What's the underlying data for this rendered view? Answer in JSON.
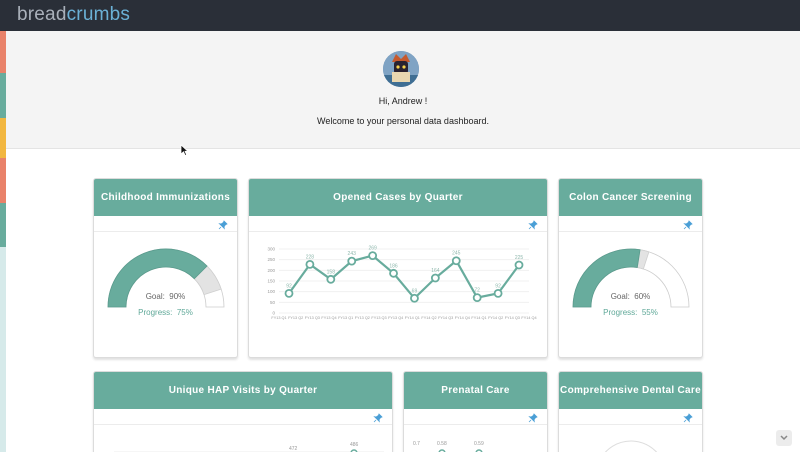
{
  "brand": {
    "part1": "bread",
    "part2": "crumbs"
  },
  "sidebar_strip_colors": [
    "#e9826a",
    "#68ac9d",
    "#f2b740",
    "#e9826a",
    "#68ac9d",
    "#d6eaea"
  ],
  "hero": {
    "greeting": "Hi, Andrew !",
    "welcome": "Welcome to your personal data dashboard."
  },
  "colors": {
    "accent": "#68ac9d",
    "header_bg": "#2a2f38",
    "pin": "#4a9fd6"
  },
  "cards": {
    "immunizations": {
      "title": "Childhood Immunizations",
      "goal_label": "Goal:",
      "goal_value": "90%",
      "progress_label": "Progress:",
      "progress_value": "75%",
      "goal": 0.9,
      "progress": 0.75
    },
    "opened_cases": {
      "title": "Opened Cases by Quarter"
    },
    "colon": {
      "title": "Colon Cancer Screening",
      "goal_label": "Goal:",
      "goal_value": "60%",
      "progress_label": "Progress:",
      "progress_value": "55%",
      "goal": 0.6,
      "progress": 0.55
    },
    "hap": {
      "title": "Unique HAP Visits by Quarter",
      "visible_labels": [
        "472",
        "486"
      ]
    },
    "prenatal": {
      "title": "Prenatal Care",
      "visible_labels": [
        "0.7",
        "0.58",
        "0.59"
      ]
    },
    "dental": {
      "title": "Comprehensive Dental Care"
    }
  },
  "chart_data": {
    "type": "line",
    "title": "Opened Cases by Quarter",
    "categories": [
      "FY13 Q1",
      "FY13 Q2",
      "FY13 Q3",
      "FY13 Q4",
      "FY13 Q1",
      "FY13 Q2",
      "FY13 Q3",
      "FY13 Q4",
      "FY14 Q1",
      "FY14 Q2",
      "FY14 Q3",
      "FY14 Q4",
      "FY14 Q1",
      "FY14 Q2",
      "FY14 Q3",
      "FY14 Q4"
    ],
    "series": [
      {
        "values": [
          92,
          228,
          158,
          243,
          269,
          186,
          69,
          164,
          245,
          72,
          92,
          225
        ]
      }
    ],
    "ylim": [
      0,
      300
    ],
    "yticks": [
      "0",
      "50",
      "100",
      "150",
      "200",
      "250",
      "300"
    ],
    "grid": true
  }
}
